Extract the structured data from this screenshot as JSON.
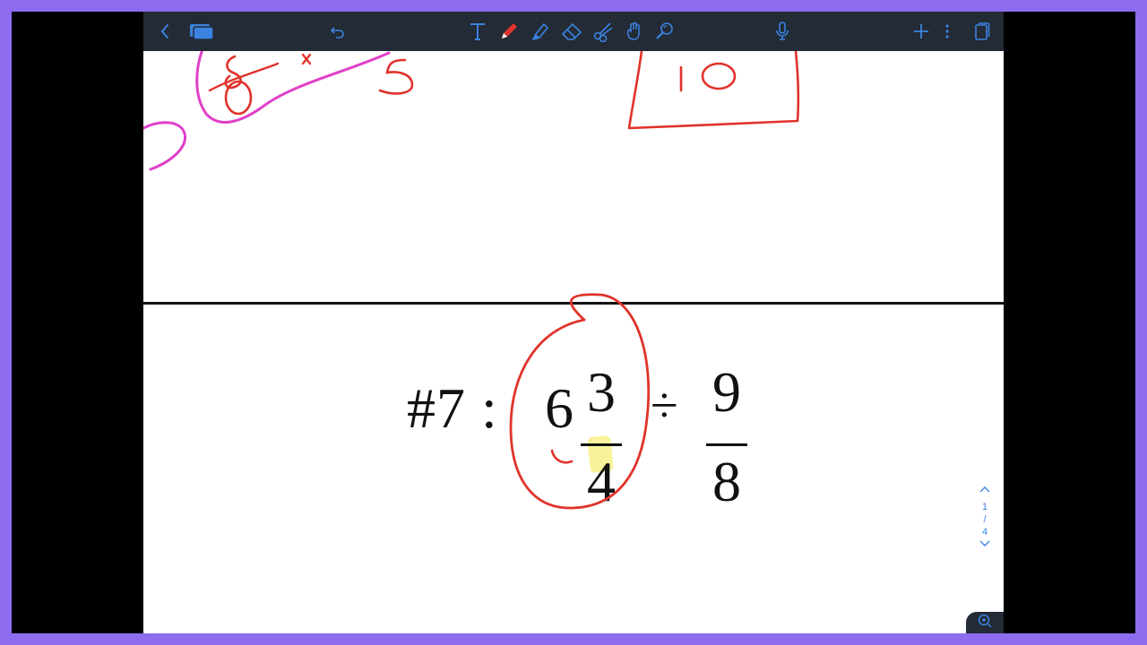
{
  "problem": {
    "label": "#7 :",
    "whole": "6",
    "frac1_num": "3",
    "frac1_den": "4",
    "operator": "÷",
    "frac2_num": "9",
    "frac2_den": "8"
  },
  "pager": {
    "current": "1",
    "separator": "/",
    "total": "4"
  },
  "colors": {
    "toolbar_bg": "#232b36",
    "icon_blue": "#3b82e0",
    "pen_red": "#e0332b",
    "ink_magenta": "#e040c8",
    "frame_purple": "#8e6cf0"
  },
  "toolbar": {
    "icons": [
      "back-icon",
      "documents-icon",
      "undo-icon",
      "text-tool-icon",
      "pen-tool-icon",
      "highlighter-tool-icon",
      "eraser-tool-icon",
      "scissors-lasso-icon",
      "hand-pointer-icon",
      "shapes-zoom-icon",
      "microphone-icon",
      "add-icon",
      "more-icon",
      "page-view-icon"
    ]
  }
}
